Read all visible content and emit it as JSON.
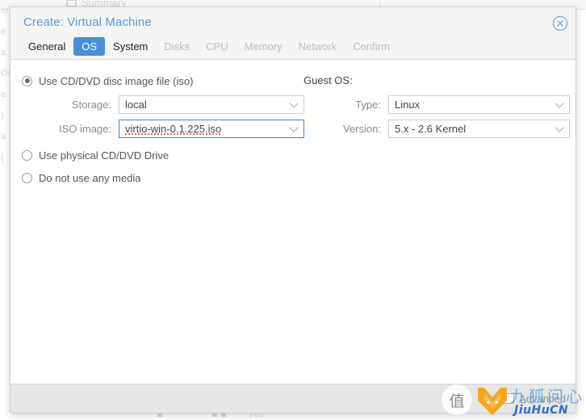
{
  "background": {
    "nav_item": "Summary",
    "nav_icon": "monitor-icon",
    "left_edge_fragments": [
      "er)",
      "e",
      "s",
      "Os",
      "e",
      ")",
      "a",
      "("
    ],
    "bottom_fragment": "yes"
  },
  "dialog": {
    "title": "Create: Virtual Machine",
    "title_color": "#5b9bd5",
    "close_icon": "close-circle-icon",
    "accent_color": "#4a90d9",
    "tabs": [
      {
        "label": "General",
        "state": "enabled"
      },
      {
        "label": "OS",
        "state": "active"
      },
      {
        "label": "System",
        "state": "enabled"
      },
      {
        "label": "Disks",
        "state": "disabled"
      },
      {
        "label": "CPU",
        "state": "disabled"
      },
      {
        "label": "Memory",
        "state": "disabled"
      },
      {
        "label": "Network",
        "state": "disabled"
      },
      {
        "label": "Confirm",
        "state": "disabled"
      }
    ],
    "media": {
      "options": [
        {
          "label": "Use CD/DVD disc image file (iso)",
          "selected": true
        },
        {
          "label": "Use physical CD/DVD Drive",
          "selected": false
        },
        {
          "label": "Do not use any media",
          "selected": false
        }
      ],
      "storage": {
        "label": "Storage:",
        "value": "local",
        "focused": false
      },
      "iso_image": {
        "label": "ISO image:",
        "value": "virtio-win-0.1.225.iso",
        "focused": true,
        "spellcheck_underline": true
      }
    },
    "guest_os": {
      "heading": "Guest OS:",
      "type": {
        "label": "Type:",
        "value": "Linux"
      },
      "version": {
        "label": "Version:",
        "value": "5.x - 2.6 Kernel"
      }
    },
    "footer": {
      "advanced_label": "Advanced",
      "advanced_checked": false
    }
  },
  "watermark": {
    "badge_char": "值",
    "logo_icon": "fox-logo-icon",
    "logo_color": "#f5a623",
    "cn_text": "九狐问心",
    "en_text": "JiuHuCN"
  }
}
